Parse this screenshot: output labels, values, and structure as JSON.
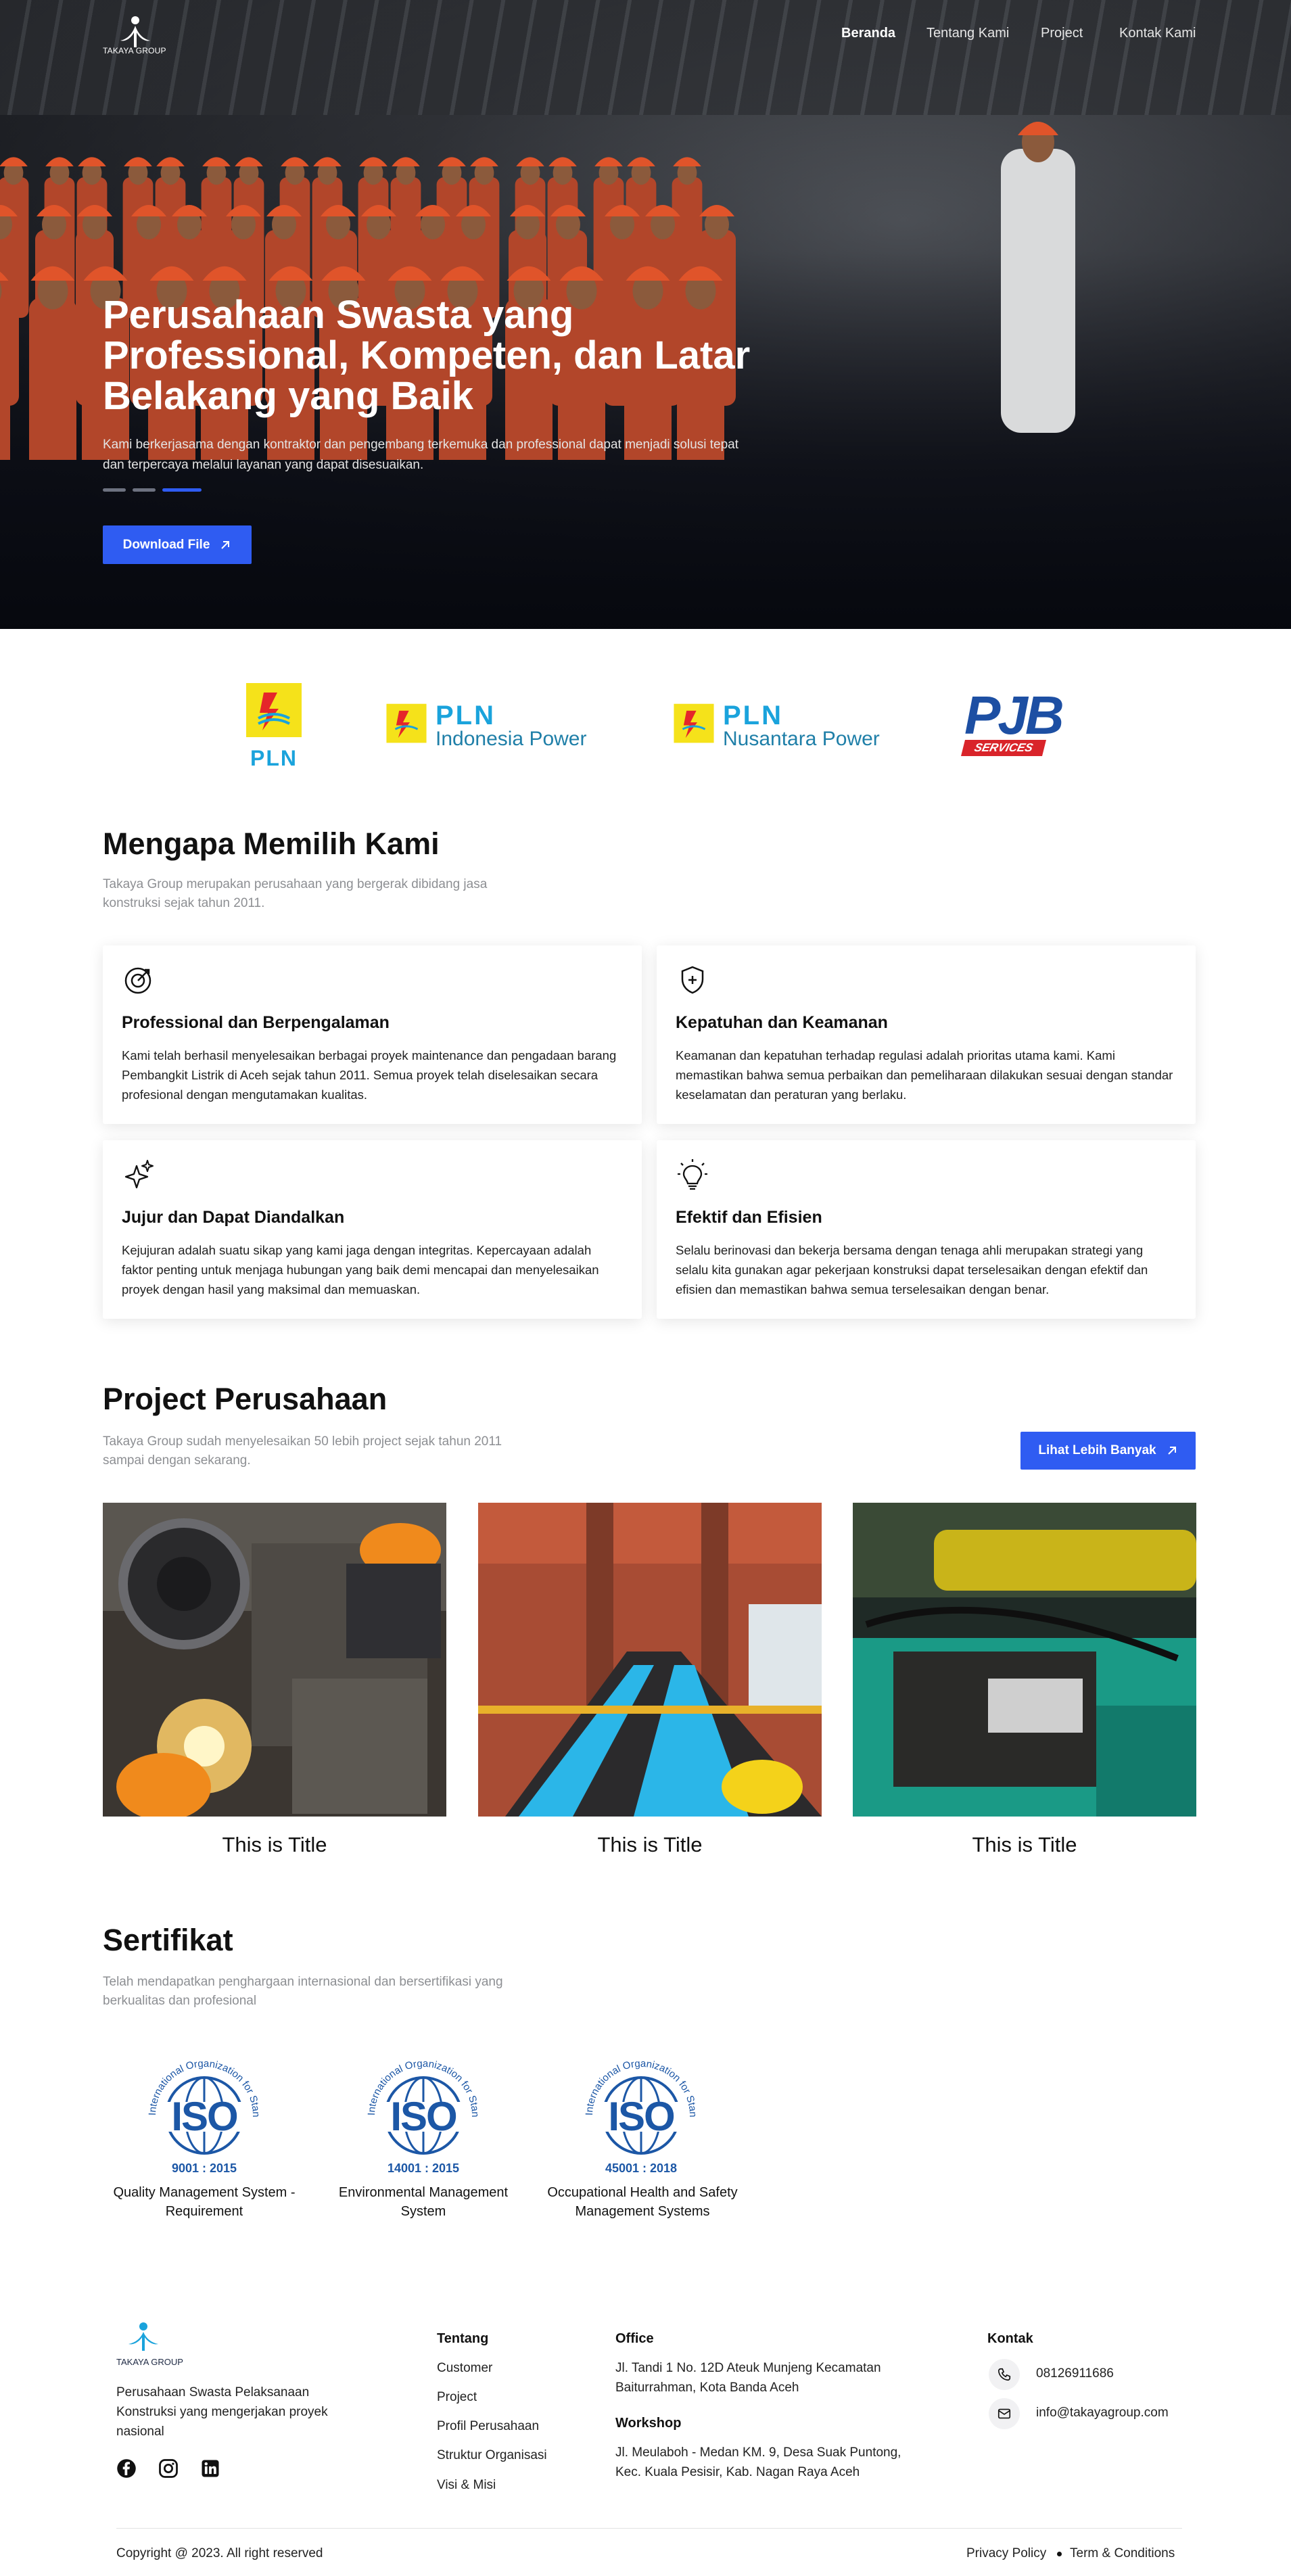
{
  "nav": {
    "logo_text": "TAKAYA GROUP",
    "items": [
      {
        "label": "Beranda",
        "active": true
      },
      {
        "label": "Tentang Kami",
        "active": false
      },
      {
        "label": "Project",
        "active": false
      },
      {
        "label": "Kontak Kami",
        "active": false
      }
    ]
  },
  "hero": {
    "title": "Perusahaan Swasta yang Professional, Kompeten, dan Latar Belakang yang Baik",
    "subtitle": "Kami berkerjasama dengan kontraktor dan pengembang terkemuka dan professional dapat menjadi solusi tepat dan terpercaya melalui layanan yang dapat disesuaikan.",
    "button": "Download File",
    "slides": 3,
    "active_slide": 3
  },
  "partners": [
    {
      "name": "PLN"
    },
    {
      "name": "PLN",
      "line2": "Indonesia Power"
    },
    {
      "name": "PLN",
      "line2": "Nusantara Power"
    },
    {
      "name": "PJB",
      "line2": "SERVICES"
    }
  ],
  "why": {
    "title": "Mengapa Memilih Kami",
    "subtitle": "Takaya Group merupakan perusahaan yang bergerak dibidang jasa konstruksi sejak tahun 2011.",
    "cards": [
      {
        "icon": "target-icon",
        "title": "Professional dan Berpengalaman",
        "desc": "Kami telah berhasil menyelesaikan berbagai proyek maintenance dan pengadaan barang Pembangkit Listrik di Aceh sejak tahun 2011. Semua proyek telah diselesaikan secara profesional dengan mengutamakan kualitas."
      },
      {
        "icon": "shield-plus-icon",
        "title": "Kepatuhan dan Keamanan",
        "desc": "Keamanan dan kepatuhan terhadap regulasi adalah prioritas utama kami. Kami memastikan bahwa semua perbaikan dan pemeliharaan dilakukan sesuai dengan standar keselamatan dan peraturan yang berlaku."
      },
      {
        "icon": "sparkles-icon",
        "title": "Jujur dan Dapat Diandalkan",
        "desc": "Kejujuran adalah suatu sikap yang kami jaga dengan integritas. Kepercayaan adalah faktor penting untuk menjaga hubungan yang baik demi mencapai dan menyelesaikan proyek dengan hasil yang maksimal dan memuaskan."
      },
      {
        "icon": "lightbulb-icon",
        "title": "Efektif dan Efisien",
        "desc": "Selalu berinovasi dan bekerja bersama dengan tenaga ahli merupakan strategi yang selalu kita gunakan agar pekerjaan konstruksi dapat terselesaikan dengan efektif dan efisien dan memastikan bahwa semua terselesaikan dengan benar."
      }
    ]
  },
  "projects": {
    "title": "Project Perusahaan",
    "subtitle": "Takaya Group sudah menyelesaikan 50 lebih project sejak tahun 2011 sampai dengan sekarang.",
    "button": "Lihat Lebih Banyak",
    "items": [
      {
        "title": "This is Title"
      },
      {
        "title": "This is Title"
      },
      {
        "title": "This is Title"
      }
    ]
  },
  "certs": {
    "title": "Sertifikat",
    "subtitle": "Telah mendapatkan penghargaan internasional dan bersertifikasi yang berkualitas dan profesional",
    "ring_text": "International Organization for Standardization",
    "items": [
      {
        "code": "9001 : 2015",
        "caption": "Quality Management System - Requirement"
      },
      {
        "code": "14001 : 2015",
        "caption": "Environmental Management System"
      },
      {
        "code": "45001 : 2018",
        "caption": "Occupational Health and Safety Management Systems"
      }
    ]
  },
  "footer": {
    "logo_text": "TAKAYA GROUP",
    "tagline": "Perusahaan Swasta Pelaksanaan Konstruksi yang mengerjakan proyek nasional",
    "tentang": {
      "head": "Tentang",
      "items": [
        "Customer",
        "Project",
        "Profil Perusahaan",
        "Struktur Organisasi",
        "Visi & Misi"
      ]
    },
    "office": {
      "head": "Office",
      "text": "Jl. Tandi 1 No. 12D Ateuk Munjeng Kecamatan Baiturrahman, Kota Banda Aceh"
    },
    "workshop": {
      "head": "Workshop",
      "text": "Jl. Meulaboh - Medan KM. 9, Desa Suak Puntong, Kec. Kuala Pesisir, Kab. Nagan Raya Aceh"
    },
    "kontak": {
      "head": "Kontak",
      "phone": "08126911686",
      "email": "info@takayagroup.com"
    },
    "copyright": "Copyright @ 2023. All right reserved",
    "privacy": "Privacy Policy",
    "terms": "Term & Conditions"
  }
}
